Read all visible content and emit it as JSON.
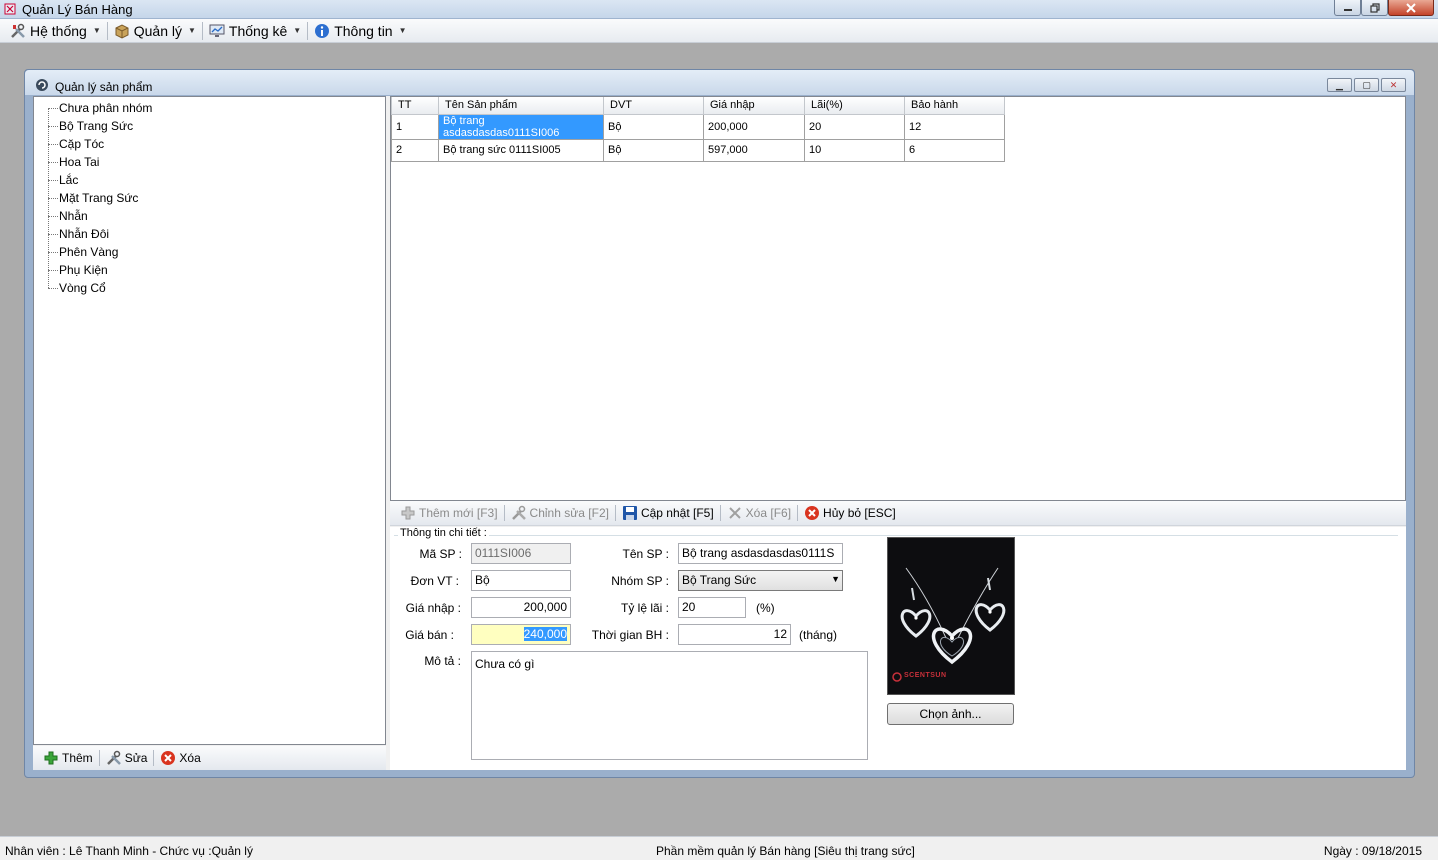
{
  "window": {
    "title": "Quản Lý Bán Hàng"
  },
  "menu": [
    {
      "label": "Hệ thống",
      "icon": "tools-icon"
    },
    {
      "label": "Quản lý",
      "icon": "box-icon"
    },
    {
      "label": "Thống kê",
      "icon": "monitor-chart-icon"
    },
    {
      "label": "Thông tin",
      "icon": "info-icon"
    }
  ],
  "child_window": {
    "title": "Quản lý sản phẩm"
  },
  "tree": {
    "items": [
      "Chưa phân nhóm",
      "Bộ Trang Sức",
      "Cặp Tóc",
      "Hoa Tai",
      "Lắc",
      "Mặt Trang Sức",
      "Nhẫn",
      "Nhẫn Đôi",
      "Phên Vàng",
      "Phụ Kiện",
      "Vòng Cổ"
    ]
  },
  "tree_toolbar": {
    "add": "Thêm",
    "edit": "Sửa",
    "delete": "Xóa"
  },
  "grid": {
    "columns": [
      "TT",
      "Tên Sản phẩm",
      "DVT",
      "Giá nhập",
      "Lãi(%)",
      "Bảo hành"
    ],
    "rows": [
      [
        "1",
        "Bộ trang asdasdasdas0111SI006",
        "Bộ",
        "200,000",
        "20",
        "12"
      ],
      [
        "2",
        "Bộ trang sức 0111SI005",
        "Bộ",
        "597,000",
        "10",
        "6"
      ]
    ]
  },
  "detail_toolbar": {
    "add": "Thêm mới [F3]",
    "edit": "Chỉnh sửa [F2]",
    "save": "Cập nhật [F5]",
    "delete": "Xóa [F6]",
    "cancel": "Hủy bỏ [ESC]"
  },
  "detail": {
    "group_title": "Thông tin chi tiết :",
    "ma_sp_label": "Mã SP :",
    "ma_sp": "0111SI006",
    "don_vt_label": "Đơn VT :",
    "don_vt": "Bộ",
    "gia_nhap_label": "Giá nhập :",
    "gia_nhap": "200,000",
    "gia_ban_label": "Giá bán :",
    "gia_ban": "240,000",
    "mo_ta_label": "Mô tả :",
    "mo_ta": "Chưa có gì",
    "ten_sp_label": "Tên SP :",
    "ten_sp": "Bộ trang asdasdasdas0111S",
    "nhom_sp_label": "Nhóm SP :",
    "nhom_sp": "Bộ Trang Sức",
    "ty_le_lai_label": "Tỷ lệ lãi :",
    "ty_le_lai": "20",
    "ty_le_lai_unit": "(%)",
    "thoi_gian_bh_label": "Thời gian BH :",
    "thoi_gian_bh": "12",
    "thoi_gian_bh_unit": "(tháng)",
    "photo_brand": "SCENTSUN",
    "choose_photo": "Chọn ảnh..."
  },
  "status": {
    "user": "Nhân viên : Lê Thanh Minh - Chức vụ :Quản lý",
    "app": "Phần mềm quản lý Bán hàng [Siêu thị trang sức]",
    "date": "Ngày : 09/18/2015"
  }
}
